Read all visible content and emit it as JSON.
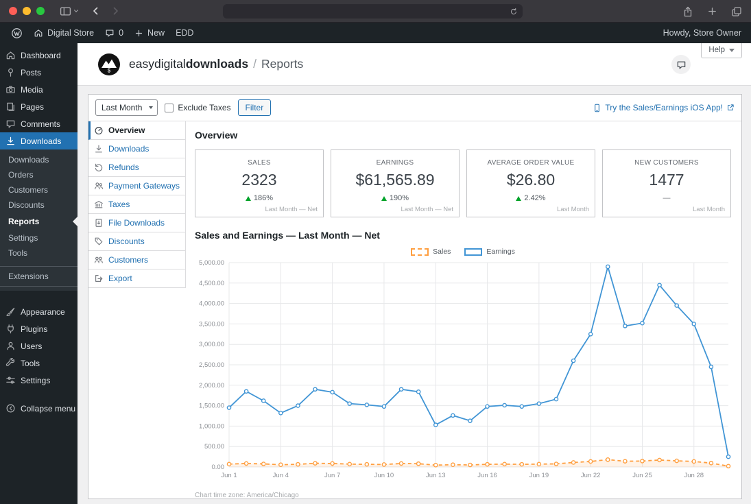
{
  "admin_bar": {
    "site_name": "Digital Store",
    "comments_count": "0",
    "new_label": "New",
    "edd_label": "EDD",
    "howdy": "Howdy, Store Owner"
  },
  "sidebar": {
    "items": [
      {
        "label": "Dashboard"
      },
      {
        "label": "Posts"
      },
      {
        "label": "Media"
      },
      {
        "label": "Pages"
      },
      {
        "label": "Comments"
      },
      {
        "label": "Downloads"
      }
    ],
    "submenu": [
      "Downloads",
      "Orders",
      "Customers",
      "Discounts",
      "Reports",
      "Settings",
      "Tools",
      "Extensions"
    ],
    "lower": [
      {
        "label": "Appearance"
      },
      {
        "label": "Plugins"
      },
      {
        "label": "Users"
      },
      {
        "label": "Tools"
      },
      {
        "label": "Settings"
      }
    ],
    "collapse_label": "Collapse menu"
  },
  "header": {
    "brand_light": "easydigital",
    "brand_bold": "downloads",
    "separator": "/",
    "page_title": "Reports",
    "logo_glyph": "$",
    "help_label": "Help"
  },
  "filter_bar": {
    "date_range": "Last Month",
    "exclude_taxes": "Exclude Taxes",
    "filter_button": "Filter",
    "ios_link": "Try the Sales/Earnings iOS App!"
  },
  "tabs": {
    "items": [
      {
        "label": "Overview"
      },
      {
        "label": "Downloads"
      },
      {
        "label": "Refunds"
      },
      {
        "label": "Payment Gateways"
      },
      {
        "label": "Taxes"
      },
      {
        "label": "File Downloads"
      },
      {
        "label": "Discounts"
      },
      {
        "label": "Customers"
      },
      {
        "label": "Export"
      }
    ]
  },
  "overview": {
    "heading": "Overview",
    "tiles": [
      {
        "label": "SALES",
        "value": "2323",
        "change": "186%",
        "direction": "up",
        "footer": "Last Month — Net"
      },
      {
        "label": "EARNINGS",
        "value": "$61,565.89",
        "change": "190%",
        "direction": "up",
        "footer": "Last Month — Net"
      },
      {
        "label": "AVERAGE ORDER VALUE",
        "value": "$26.80",
        "change": "2.42%",
        "direction": "up",
        "footer": "Last Month"
      },
      {
        "label": "NEW CUSTOMERS",
        "value": "1477",
        "change": "—",
        "direction": "none",
        "footer": "Last Month"
      }
    ],
    "chart_heading": "Sales and Earnings — Last Month — Net"
  },
  "chart_data": {
    "type": "line",
    "title": "Sales and Earnings — Last Month — Net",
    "x": [
      "Jun 1",
      "Jun 2",
      "Jun 3",
      "Jun 4",
      "Jun 5",
      "Jun 6",
      "Jun 7",
      "Jun 8",
      "Jun 9",
      "Jun 10",
      "Jun 11",
      "Jun 12",
      "Jun 13",
      "Jun 14",
      "Jun 15",
      "Jun 16",
      "Jun 17",
      "Jun 18",
      "Jun 19",
      "Jun 20",
      "Jun 21",
      "Jun 22",
      "Jun 23",
      "Jun 24",
      "Jun 25",
      "Jun 26",
      "Jun 27",
      "Jun 28",
      "Jun 29",
      "Jun 30"
    ],
    "tick_every": 3,
    "ylim": [
      0,
      5000
    ],
    "ytick_step": 500,
    "grid": true,
    "legend_position": "top",
    "series": [
      {
        "name": "Sales",
        "color": "#ff9f40",
        "dashed": true,
        "fill": "rgba(255,159,64,0.12)",
        "values": [
          70,
          85,
          75,
          55,
          65,
          90,
          85,
          70,
          65,
          60,
          85,
          80,
          45,
          55,
          50,
          65,
          70,
          65,
          70,
          75,
          110,
          135,
          180,
          140,
          145,
          170,
          150,
          135,
          95,
          20
        ]
      },
      {
        "name": "Earnings",
        "color": "#4195d5",
        "dashed": false,
        "fill": null,
        "values": [
          1450,
          1850,
          1620,
          1320,
          1500,
          1900,
          1830,
          1550,
          1520,
          1480,
          1900,
          1840,
          1030,
          1260,
          1130,
          1480,
          1510,
          1480,
          1550,
          1660,
          2600,
          3250,
          4900,
          3450,
          3520,
          4450,
          3950,
          3500,
          2450,
          250
        ]
      }
    ],
    "timezone_note": "Chart time zone: America/Chicago"
  }
}
